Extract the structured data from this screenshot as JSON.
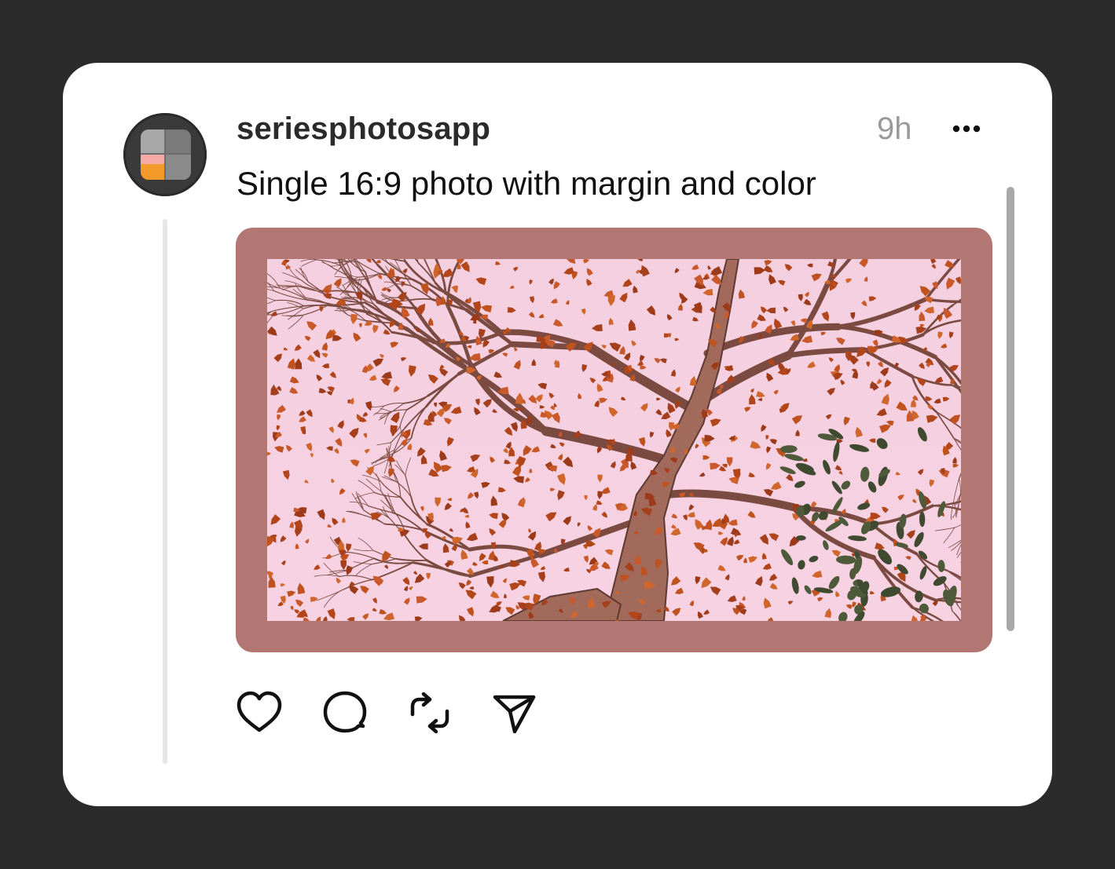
{
  "post": {
    "username": "seriesphotosapp",
    "timestamp": "9h",
    "caption": "Single 16:9 photo with margin and color",
    "frame_color": "#b27673",
    "photo_description_icon": "autumn-tree-photo"
  },
  "icons": {
    "avatar": "app-logo-icon",
    "more": "more-options-icon",
    "like": "heart-icon",
    "comment": "comment-bubble-icon",
    "repost": "repost-icon",
    "share": "send-icon"
  },
  "colors": {
    "background": "#2b2b2b",
    "card": "#ffffff",
    "accent_orange": "#f49a2a",
    "accent_pink": "#f6aaa5"
  }
}
